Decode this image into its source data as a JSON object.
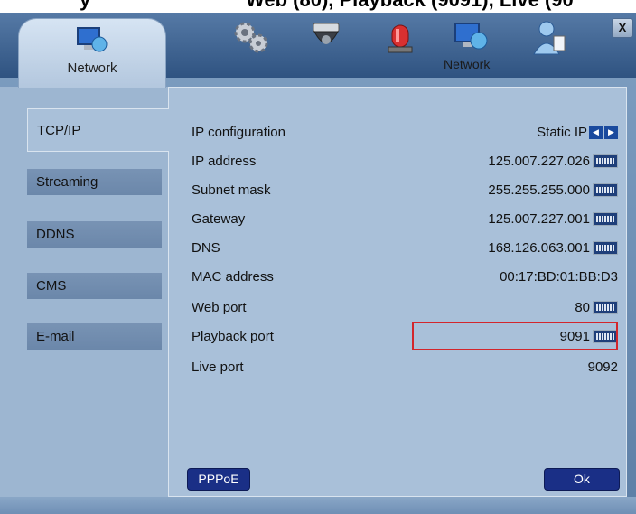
{
  "top_fragment": {
    "left_text": "y",
    "mid_text": "Web (80), Playback (9091), Live (90"
  },
  "toolbar": {
    "active_tab_label": "Network",
    "tools": [
      {
        "icon": "gears-icon"
      },
      {
        "icon": "camera-icon"
      },
      {
        "icon": "alarm-light-icon"
      },
      {
        "icon": "network-icon",
        "label": "Network"
      },
      {
        "icon": "user-icon"
      }
    ],
    "close_label": "X"
  },
  "sidebar": {
    "items": [
      {
        "label": "TCP/IP"
      },
      {
        "label": "Streaming"
      },
      {
        "label": "DDNS"
      },
      {
        "label": "CMS"
      },
      {
        "label": "E-mail"
      }
    ]
  },
  "settings": [
    {
      "key": "IP configuration",
      "value": "Static IP",
      "control": "arrows"
    },
    {
      "key": "IP address",
      "value": "125.007.227.026",
      "control": "keyboard"
    },
    {
      "key": "Subnet mask",
      "value": "255.255.255.000",
      "control": "keyboard"
    },
    {
      "key": "Gateway",
      "value": "125.007.227.001",
      "control": "keyboard"
    },
    {
      "key": "DNS",
      "value": "168.126.063.001",
      "control": "keyboard"
    },
    {
      "key": "MAC address",
      "value": "00:17:BD:01:BB:D3",
      "control": "none"
    },
    {
      "key": "Web port",
      "value": "80",
      "control": "keyboard"
    },
    {
      "key": "Playback port",
      "value": "9091",
      "control": "keyboard"
    },
    {
      "key": "Live port",
      "value": "9092",
      "control": "none"
    }
  ],
  "buttons": {
    "pppoe": "PPPoE",
    "ok": "Ok"
  }
}
